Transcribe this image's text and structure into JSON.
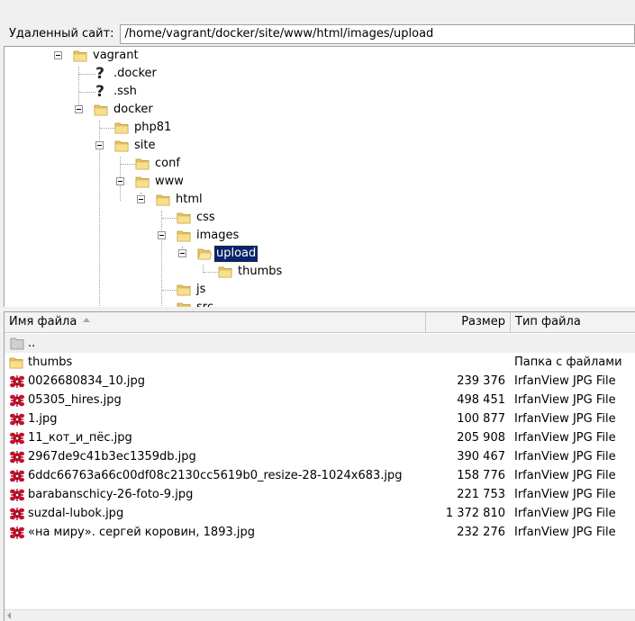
{
  "remote_site": {
    "label": "Удаленный сайт:",
    "path": "/home/vagrant/docker/site/www/html/images/upload"
  },
  "tree": {
    "nodes": [
      {
        "label": "vagrant",
        "icon": "folder-icon"
      },
      {
        "label": ".docker",
        "icon": "question-mark-icon"
      },
      {
        "label": ".ssh",
        "icon": "question-mark-icon"
      },
      {
        "label": "docker",
        "icon": "folder-icon"
      },
      {
        "label": "php81",
        "icon": "folder-icon"
      },
      {
        "label": "site",
        "icon": "folder-icon"
      },
      {
        "label": "conf",
        "icon": "folder-icon"
      },
      {
        "label": "www",
        "icon": "folder-icon"
      },
      {
        "label": "html",
        "icon": "folder-icon"
      },
      {
        "label": "css",
        "icon": "folder-icon"
      },
      {
        "label": "images",
        "icon": "folder-icon"
      },
      {
        "label": "upload",
        "icon": "folder-open-icon",
        "selected": true
      },
      {
        "label": "thumbs",
        "icon": "folder-icon"
      },
      {
        "label": "js",
        "icon": "folder-icon"
      },
      {
        "label": "src",
        "icon": "folder-icon"
      }
    ]
  },
  "file_list": {
    "columns": {
      "name": "Имя файла",
      "size": "Размер",
      "type": "Тип файла"
    },
    "sort_column": "name",
    "rows": [
      {
        "name": "..",
        "size": "",
        "type": "",
        "icon": "folder-up-icon"
      },
      {
        "name": "thumbs",
        "size": "",
        "type": "Папка с файлами",
        "icon": "folder-icon"
      },
      {
        "name": "0026680834_10.jpg",
        "size": "239 376",
        "type": "IrfanView JPG File",
        "icon": "irfanview-icon"
      },
      {
        "name": "05305_hires.jpg",
        "size": "498 451",
        "type": "IrfanView JPG File",
        "icon": "irfanview-icon"
      },
      {
        "name": "1.jpg",
        "size": "100 877",
        "type": "IrfanView JPG File",
        "icon": "irfanview-icon"
      },
      {
        "name": "11_кот_и_пёс.jpg",
        "size": "205 908",
        "type": "IrfanView JPG File",
        "icon": "irfanview-icon"
      },
      {
        "name": "2967de9c41b3ec1359db.jpg",
        "size": "390 467",
        "type": "IrfanView JPG File",
        "icon": "irfanview-icon"
      },
      {
        "name": "6ddc66763a66c00df08c2130cc5619b0_resize-28-1024x683.jpg",
        "size": "158 776",
        "type": "IrfanView JPG File",
        "icon": "irfanview-icon"
      },
      {
        "name": "barabanschicy-26-foto-9.jpg",
        "size": "221 753",
        "type": "IrfanView JPG File",
        "icon": "irfanview-icon"
      },
      {
        "name": "suzdal-lubok.jpg",
        "size": "1 372 810",
        "type": "IrfanView JPG File",
        "icon": "irfanview-icon"
      },
      {
        "name": "«на миру». сергей коровин, 1893.jpg",
        "size": "232 276",
        "type": "IrfanView JPG File",
        "icon": "irfanview-icon"
      }
    ]
  },
  "colors": {
    "selection": "#0a246a",
    "folder": "#f5d879",
    "irfanview": "#c8102e"
  }
}
